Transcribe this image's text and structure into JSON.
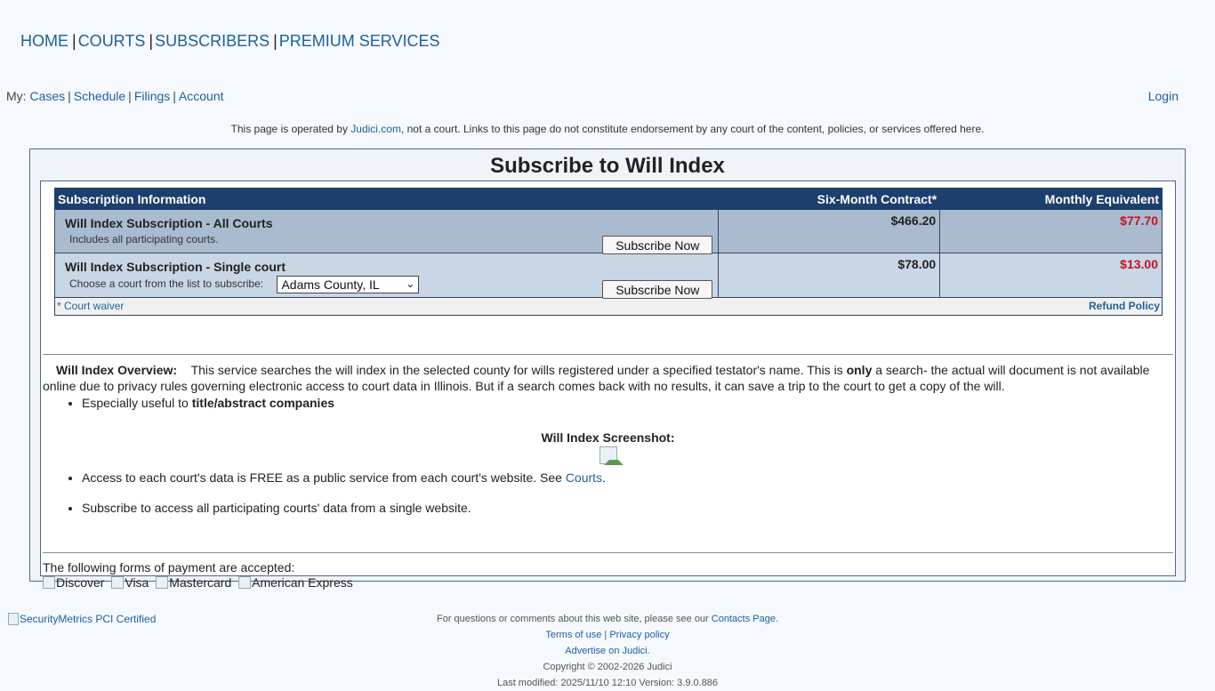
{
  "nav": {
    "items": [
      "HOME",
      "COURTS",
      "SUBSCRIBERS",
      "PREMIUM SERVICES"
    ],
    "separator": "|"
  },
  "mybar": {
    "prefix": "My:",
    "links": [
      "Cases",
      "Schedule",
      "Filings",
      "Account"
    ],
    "separator": "|"
  },
  "login": "Login",
  "disclaimer": {
    "before": "This page is operated by ",
    "link": "Judici.com",
    "after": ", not a court. Links to this page do not constitute endorsement by any court of the content, policies, or services offered here."
  },
  "page_title": "Subscribe to Will Index",
  "table": {
    "headers": [
      "Subscription Information",
      "Six-Month Contract*",
      "Monthly Equivalent"
    ],
    "rows": [
      {
        "name": "Will Index Subscription - All Courts",
        "desc": "Includes all participating courts.",
        "button": "Subscribe Now",
        "six_month": "$466.20",
        "monthly": "$77.70"
      },
      {
        "name": "Will Index Subscription - Single court",
        "desc": "Choose a court from the list to subscribe:",
        "select_value": "Adams County, IL",
        "button": "Subscribe Now",
        "six_month": "$78.00",
        "monthly": "$13.00"
      }
    ],
    "court_waiver": "* Court waiver",
    "refund_policy": "Refund Policy"
  },
  "overview": {
    "title": "Will Index Overview:",
    "text_before": "This service searches the will index in the selected county for wills registered under a specified testator's name. This is ",
    "text_bold": "only",
    "text_after": " a search- the actual will document is not available online due to privacy rules governing electronic access to court data in Illinois. But if a search comes back with no results, it can save a trip to the court to get a copy of the will."
  },
  "bullet1": {
    "before": "Especially useful to ",
    "bold": "title/abstract companies"
  },
  "screenshot_label": "Will Index Screenshot:",
  "bullet2": {
    "before": "Access to each court's data is FREE as a public service from each court's website. See ",
    "link": "Courts",
    "after": "."
  },
  "bullet3": "Subscribe to access all participating courts' data from a single website.",
  "payment": {
    "label": "The following forms of payment are accepted:",
    "cards": [
      "Discover",
      "Visa",
      "Mastercard",
      "American Express"
    ]
  },
  "footer": {
    "security": "SecurityMetrics PCI Certified",
    "questions_before": "For questions or comments about this web site, please see our ",
    "contacts": "Contacts Page",
    "questions_after": ".",
    "terms": "Terms of use",
    "sep": "|",
    "privacy": "Privacy policy",
    "advertise": "Advertise on Judici",
    "advertise_after": ".",
    "copyright": "Copyright © 2002-2026 Judici",
    "last_modified": "Last modified: 2025/11/10 12:10 Version: 3.9.0.886"
  },
  "colors": {
    "header_bg": "#1c3f6e",
    "link": "#1f5f99",
    "price_red": "#c4131e",
    "row1_bg": "#aabbd0",
    "row2_bg": "#c9d6e6"
  }
}
